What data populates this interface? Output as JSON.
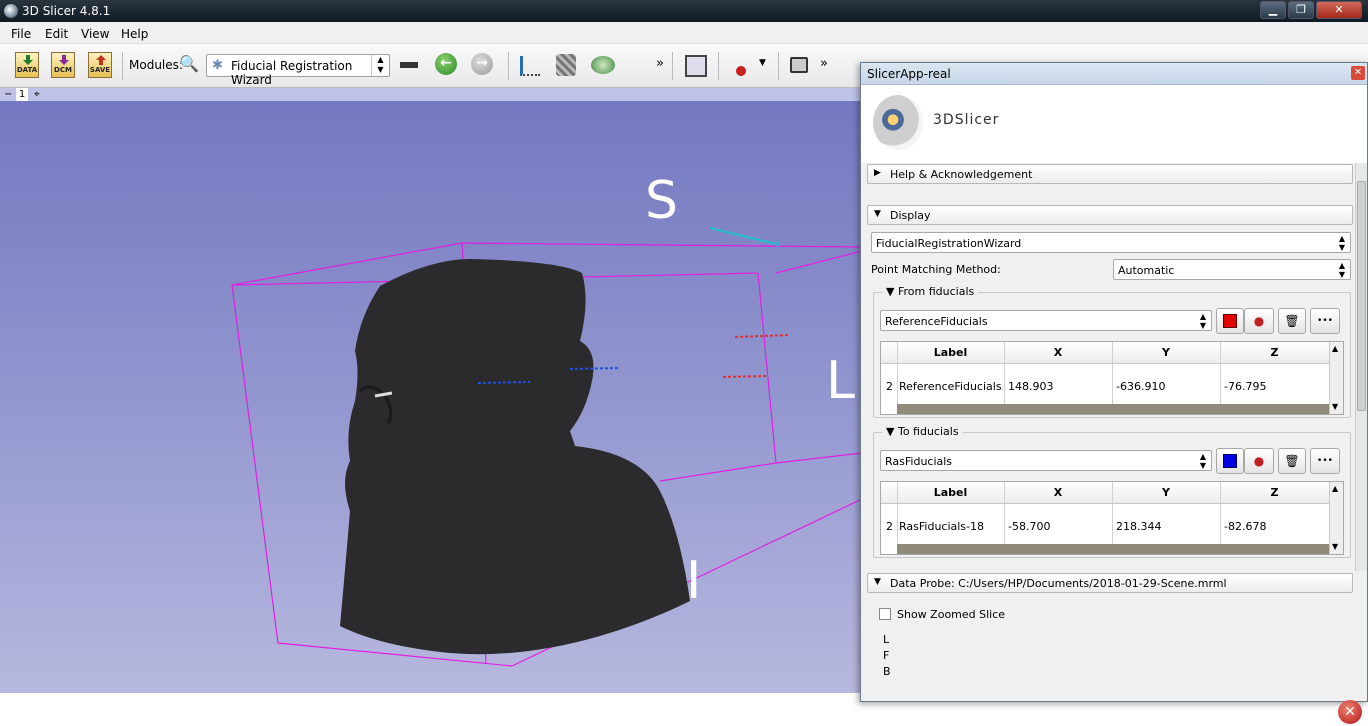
{
  "window": {
    "title": "3D Slicer 4.8.1",
    "controls": {
      "minimize": "▁",
      "maximize": "❐",
      "close": "✕"
    }
  },
  "menubar": [
    "File",
    "Edit",
    "View",
    "Help"
  ],
  "toolbar": {
    "data_label": "DATA",
    "dcm_label": "DCM",
    "save_label": "SAVE",
    "modules_label": "Modules:",
    "module_selected": "Fiducial Registration Wizard",
    "more_glyph": "»"
  },
  "viewbar": {
    "collapse": "−",
    "number": "1",
    "pin": "⌖"
  },
  "view3d": {
    "orientation_labels": {
      "superior": "S",
      "left": "L",
      "inferior": "I"
    },
    "box_color": "#e020e0",
    "background_top": "#7478c0",
    "background_bottom": "#b6b8de"
  },
  "panel": {
    "title": "SlicerApp-real",
    "logo_text": "3DSlicer",
    "help_section": "Help & Acknowledgement",
    "display_section": "Display",
    "registration_node": "FiducialRegistrationWizard",
    "point_matching_label": "Point Matching Method:",
    "point_matching_value": "Automatic",
    "from": {
      "title": "From fiducials",
      "list": "ReferenceFiducials",
      "color": "#e00000",
      "columns": [
        "Label",
        "X",
        "Y",
        "Z"
      ],
      "row": {
        "index": "2",
        "label": "ReferenceFiducials...",
        "x": "148.903",
        "y": "-636.910",
        "z": "-76.795"
      }
    },
    "to": {
      "title": "To fiducials",
      "list": "RasFiducials",
      "color": "#0000e0",
      "columns": [
        "Label",
        "X",
        "Y",
        "Z"
      ],
      "row": {
        "index": "2",
        "label": "RasFiducials-18",
        "x": "-58.700",
        "y": "218.344",
        "z": "-82.678"
      }
    },
    "data_probe": "Data Probe: C:/Users/HP/Documents/2018-01-29-Scene.mrml",
    "show_zoomed_slice": "Show Zoomed Slice",
    "probe_lines": [
      "L",
      "F",
      "B"
    ],
    "more_glyph": "•••"
  },
  "close_badge": "✕"
}
